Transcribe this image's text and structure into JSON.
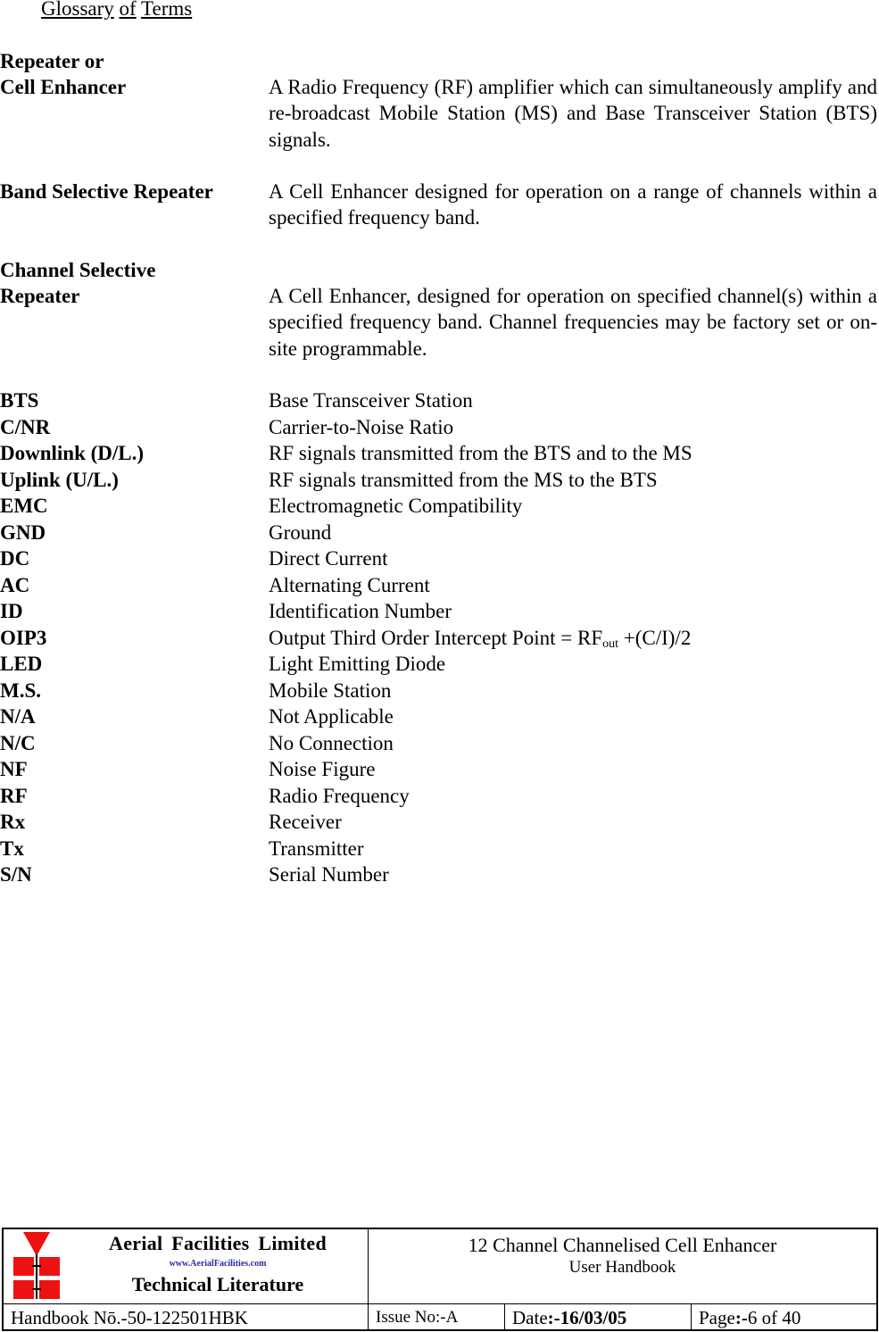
{
  "page_title": {
    "word1": "Glossary",
    "word2": "of",
    "word3": "Terms"
  },
  "long_terms": [
    {
      "term_line1": "Repeater or",
      "term_line2": "Cell Enhancer",
      "definition": "A Radio Frequency (RF) amplifier which can simultaneously amplify and re-broadcast Mobile Station (MS) and Base Transceiver Station (BTS) signals."
    },
    {
      "term_line1": "Band Selective Repeater",
      "definition": "A Cell Enhancer designed for operation on a range of channels within a specified frequency band."
    },
    {
      "term_line1": "Channel Selective",
      "term_line2": "Repeater",
      "definition": "A Cell Enhancer, designed for operation on specified channel(s) within a specified frequency band. Channel frequencies may be factory set or on-site programmable."
    }
  ],
  "abbreviations": [
    {
      "abbr": "BTS",
      "meaning": "Base Transceiver Station"
    },
    {
      "abbr": "C/NR",
      "meaning": "Carrier-to-Noise Ratio"
    },
    {
      "abbr": "Downlink (D/L.)",
      "meaning": "RF signals transmitted from the BTS and to the MS"
    },
    {
      "abbr": "Uplink (U/L.)",
      "meaning": "RF signals transmitted from the MS to the BTS"
    },
    {
      "abbr": "EMC",
      "meaning": "Electromagnetic Compatibility"
    },
    {
      "abbr": "GND",
      "meaning": "Ground"
    },
    {
      "abbr": "DC",
      "meaning": "Direct Current"
    },
    {
      "abbr": "AC",
      "meaning": "Alternating Current"
    },
    {
      "abbr": "ID",
      "meaning": "Identification Number"
    },
    {
      "abbr": "OIP3",
      "meaning_pre": "Output Third Order Intercept Point = RF",
      "meaning_sub": "out",
      "meaning_post": " +(C/I)/2"
    },
    {
      "abbr": "LED",
      "meaning": "Light Emitting Diode"
    },
    {
      "abbr": "M.S.",
      "meaning": "Mobile Station"
    },
    {
      "abbr": "N/A",
      "meaning": "Not Applicable"
    },
    {
      "abbr": "N/C",
      "meaning": "No Connection"
    },
    {
      "abbr": "NF",
      "meaning": "Noise Figure"
    },
    {
      "abbr": "RF",
      "meaning": "Radio Frequency"
    },
    {
      "abbr": "Rx",
      "meaning": "Receiver"
    },
    {
      "abbr": "Tx",
      "meaning": "Transmitter"
    },
    {
      "abbr": "S/N",
      "meaning": "Serial Number"
    }
  ],
  "footer": {
    "logo": {
      "company": "Aerial  Facilities  Limited",
      "website": "www.AerialFacilities.com",
      "tagline": "Technical Literature",
      "icon": "aerial-facilities-logo-icon",
      "icon_color": "#ee1111",
      "website_color": "#2a2aa8"
    },
    "doc_title": "12 Channel Channelised Cell Enhancer",
    "doc_subtitle": "User Handbook",
    "handbook_no": "Handbook Nō.-50-122501HBK",
    "issue_label": "Issue No:-",
    "issue_value": "A",
    "date_label": "Date",
    "date_value": ":-16/03/05",
    "page_label": "Page",
    "page_sep": ":-",
    "page_value": "6 of 40"
  }
}
